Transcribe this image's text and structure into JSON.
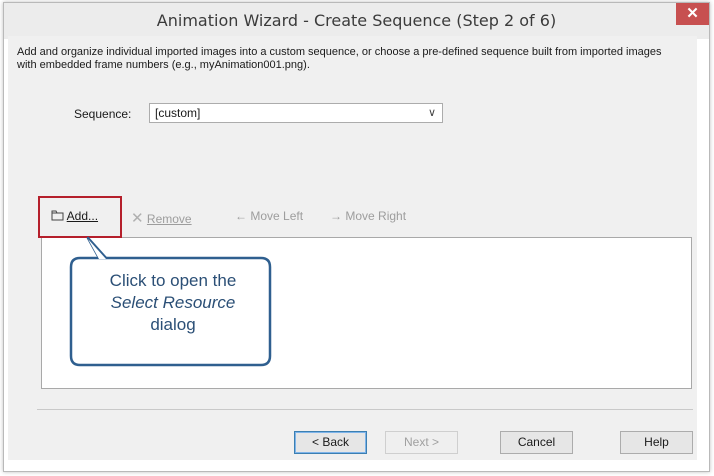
{
  "window": {
    "title": "Animation Wizard - Create Sequence (Step 2 of 6)",
    "close_glyph": "✕"
  },
  "description": "Add and organize individual imported images into a custom sequence, or choose a pre-defined sequence built from imported images with embedded frame numbers (e.g., myAnimation001.png).",
  "sequence": {
    "label": "Sequence:",
    "value": "[custom]",
    "chevron": "∨"
  },
  "toolbar": {
    "add": {
      "icon": "folder-add-icon",
      "label": "Add..."
    },
    "remove": {
      "icon": "x-icon",
      "label": "Remove"
    },
    "move_left": {
      "icon": "arrow-left-icon",
      "label": "Move Left"
    },
    "move_right": {
      "icon": "arrow-right-icon",
      "label": "Move Right"
    }
  },
  "callout": {
    "line1": "Click to open the",
    "line2": "Select Resource",
    "line3": "dialog"
  },
  "buttons": {
    "back": "< Back",
    "next": "Next >",
    "cancel": "Cancel",
    "help": "Help"
  },
  "colors": {
    "highlight": "#b51f2b",
    "callout_border": "#2f5f8f",
    "close": "#c75050"
  }
}
